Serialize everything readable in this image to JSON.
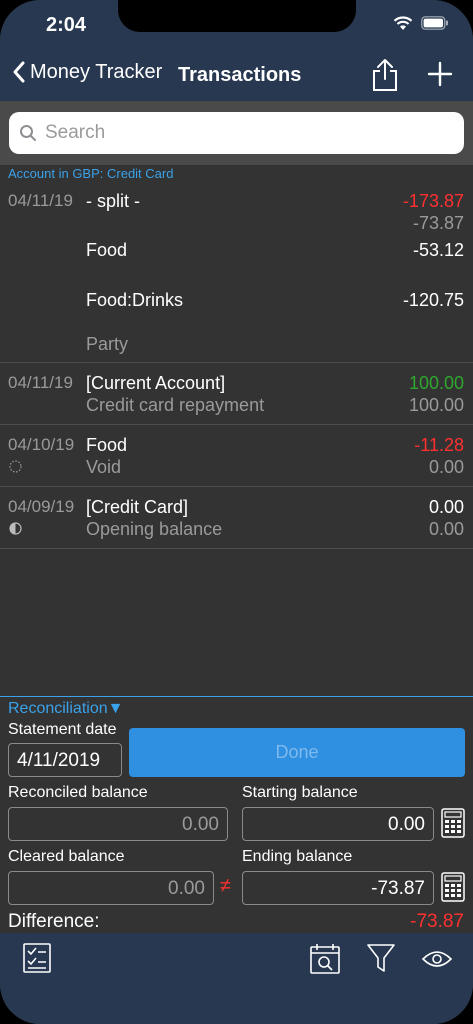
{
  "status": {
    "time": "2:04"
  },
  "nav": {
    "back_label": "Money Tracker",
    "title": "Transactions"
  },
  "search": {
    "placeholder": "Search"
  },
  "account_header": "Account in GBP: Credit Card",
  "transactions": [
    {
      "date": "04/11/19",
      "payee": "- split -",
      "amount": "-173.87",
      "balance": "-73.87",
      "amount_color": "red",
      "splits": [
        {
          "category": "Food",
          "amount": "-53.12"
        },
        {
          "category": "Food:Drinks",
          "amount": "-120.75"
        }
      ],
      "memo": "Party"
    },
    {
      "date": "04/11/19",
      "payee": "[Current Account]",
      "memo": "Credit card repayment",
      "amount": "100.00",
      "balance": "100.00",
      "amount_color": "green"
    },
    {
      "date": "04/10/19",
      "payee": "Food",
      "memo": "Void",
      "amount": "-11.28",
      "balance": "0.00",
      "amount_color": "red",
      "status_icon": "dotted-circle-icon"
    },
    {
      "date": "04/09/19",
      "payee": "[Credit Card]",
      "memo": "Opening balance",
      "amount": "0.00",
      "balance": "0.00",
      "amount_color": "white",
      "status_icon": "half-circle-icon"
    }
  ],
  "reconciliation": {
    "title": "Reconciliation▼",
    "statement_date_label": "Statement date",
    "statement_date": "4/11/2019",
    "done_label": "Done",
    "reconciled_balance_label": "Reconciled balance",
    "reconciled_balance": "0.00",
    "starting_balance_label": "Starting balance",
    "starting_balance": "0.00",
    "cleared_balance_label": "Cleared balance",
    "cleared_balance": "0.00",
    "not_equal": "≠",
    "ending_balance_label": "Ending balance",
    "ending_balance": "-73.87",
    "difference_label": "Difference:",
    "difference": "-73.87"
  },
  "colors": {
    "accent": "#3aa2ea",
    "bar": "#273850",
    "negative": "#ff3030",
    "positive": "#2ea82e"
  }
}
